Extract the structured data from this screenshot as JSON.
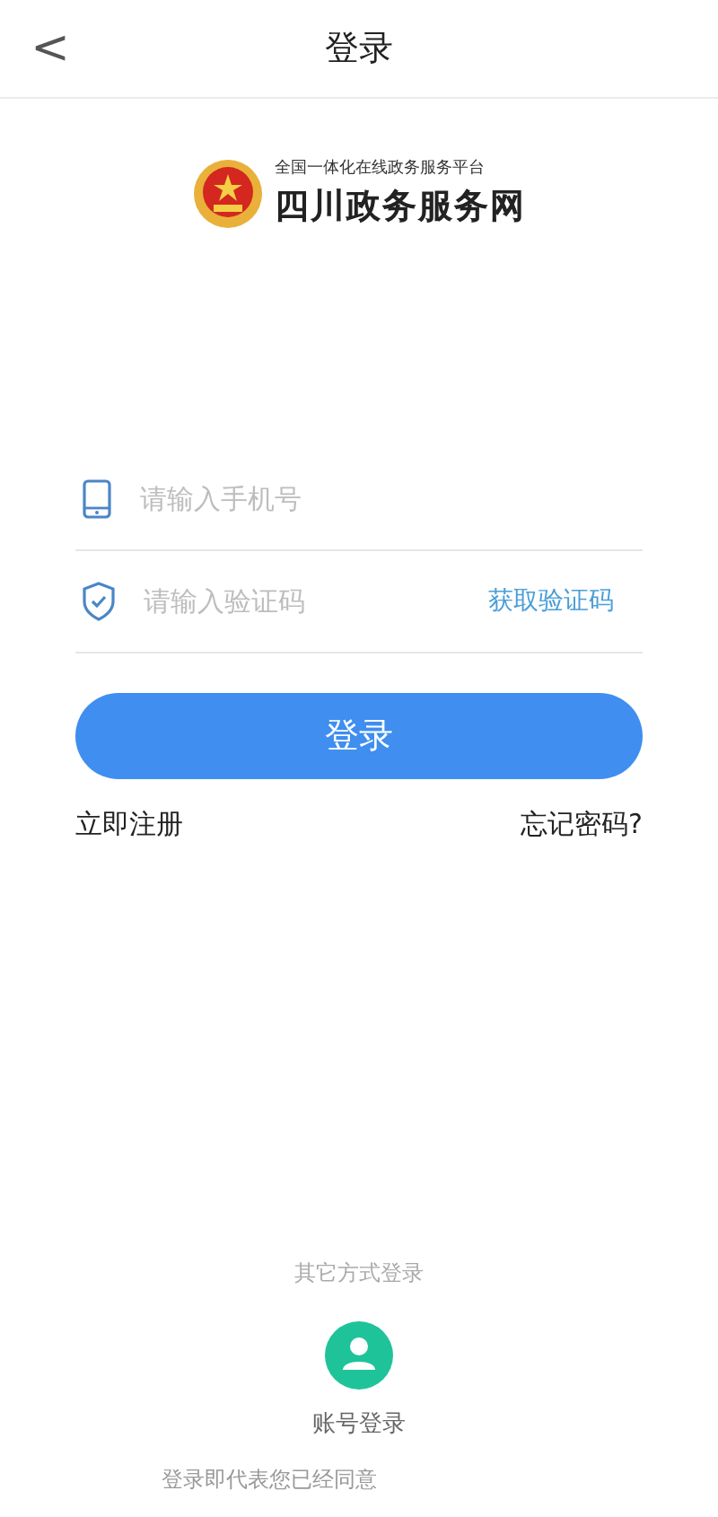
{
  "header": {
    "back": "<",
    "title": "登录"
  },
  "brand": {
    "tagline": "全国一体化在线政务服务平台",
    "name": "四川政务服务网"
  },
  "fields": [
    {
      "kind": "phone",
      "placeholder": "请输入手机号"
    },
    {
      "kind": "code",
      "placeholder": "请输入验证码",
      "action": "获取验证码"
    }
  ],
  "login_button": "登录",
  "links": {
    "register": "立即注册",
    "forgot": "忘记密码?"
  },
  "other_login": {
    "title": "其它方式登录",
    "methods": [
      {
        "label": "账号登录"
      }
    ]
  },
  "agreement": "登录即代表您已经同意"
}
